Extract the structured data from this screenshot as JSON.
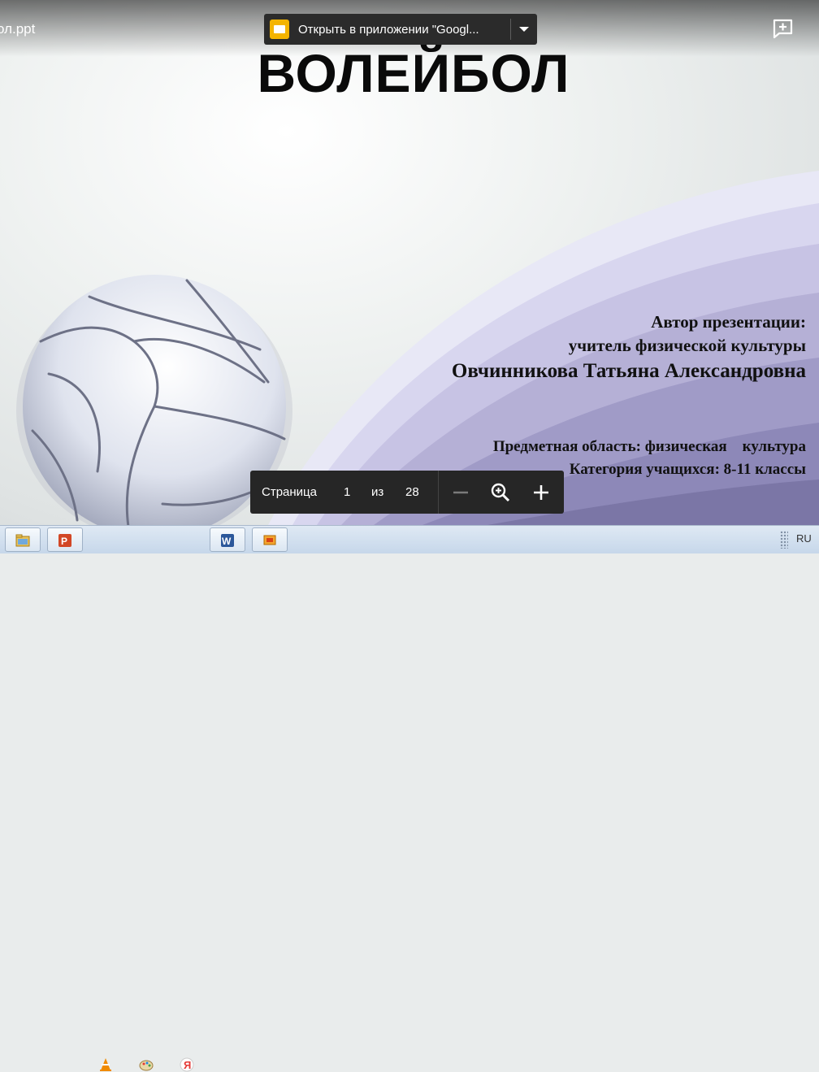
{
  "viewer": {
    "file_name": "ол.ppt",
    "open_in_app_label": "Открыть в приложении \"Googl...",
    "open_icon": "google-slides-icon",
    "comment_icon": "add-comment-icon"
  },
  "slide": {
    "title": "ВОЛЕЙБОЛ",
    "author_heading": "Автор презентации:",
    "author_role": "учитель физической культуры",
    "author_name": "Овчинникова Татьяна Александровна",
    "subject": "Предметная область: физическая    культура",
    "category": "Категория учащихся: 8-11 классы"
  },
  "pager": {
    "page_label": "Страница",
    "current_page": "1",
    "of_label": "из",
    "total_pages": "28"
  },
  "taskbar": {
    "items": [
      "explorer",
      "powerpoint",
      "vlc",
      "paint",
      "yandex-browser",
      "word",
      "presentation"
    ],
    "language": "RU"
  },
  "colors": {
    "chrome_dark": "#262626",
    "slides_yellow": "#f4b400",
    "wave_purple": "#8d88b8"
  }
}
